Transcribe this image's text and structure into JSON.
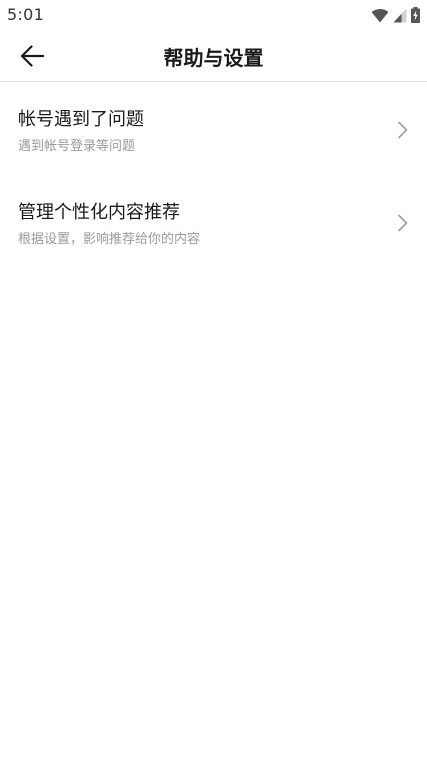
{
  "status_bar": {
    "time": "5:01",
    "icons": [
      "wifi-icon",
      "cellular-signal-icon",
      "battery-charging-icon"
    ]
  },
  "header": {
    "back_icon": "arrow-left-icon",
    "title": "帮助与设置"
  },
  "items": [
    {
      "title": "帐号遇到了问题",
      "subtitle": "遇到帐号登录等问题",
      "icon": "chevron-right-icon"
    },
    {
      "title": "管理个性化内容推荐",
      "subtitle": "根据设置，影响推荐给你的内容",
      "icon": "chevron-right-icon"
    }
  ],
  "colors": {
    "background": "#ffffff",
    "title_text": "#1a1a1a",
    "subtitle_text": "#9a9a9a",
    "chevron": "#9e9e9e",
    "divider": "#e2e2e2"
  }
}
